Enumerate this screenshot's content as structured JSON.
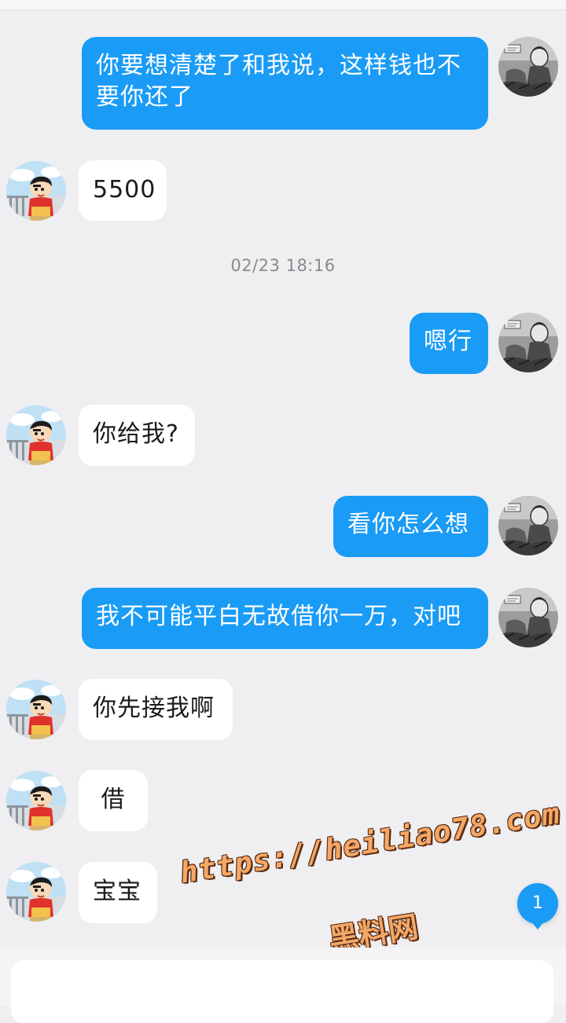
{
  "timestamp": "02/23 18:16",
  "messages": [
    {
      "side": "out",
      "text": "你要想清楚了和我说，这样钱也不要你还了"
    },
    {
      "side": "in",
      "text": "5500"
    },
    {
      "side": "out",
      "text": "嗯行"
    },
    {
      "side": "in",
      "text": "你给我?"
    },
    {
      "side": "out",
      "text": "看你怎么想"
    },
    {
      "side": "out",
      "text": "我不可能平白无故借你一万，对吧"
    },
    {
      "side": "in",
      "text": "你先接我啊"
    },
    {
      "side": "in",
      "text": "借"
    },
    {
      "side": "in",
      "text": "宝宝"
    }
  ],
  "unread_badge": "1",
  "watermark": {
    "url": "https://heiliao78.com",
    "name": "黑料网"
  },
  "avatars": {
    "self": "grayscale-manga-avatar",
    "contact": "crayon-boy-avatar"
  },
  "colors": {
    "outgoing_bubble": "#1a9bf5",
    "incoming_bubble": "#ffffff",
    "background": "#efeff1"
  }
}
